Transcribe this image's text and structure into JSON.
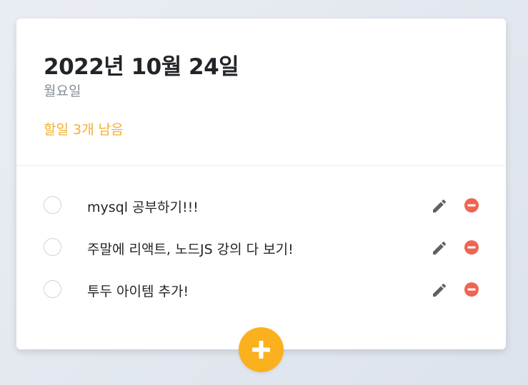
{
  "header": {
    "date": "2022년 10월 24일",
    "weekday": "월요일",
    "tasks_left": "할일 3개 남음"
  },
  "todos": [
    {
      "text": "mysql 공부하기!!!",
      "done": false
    },
    {
      "text": "주말에 리액트, 노드JS 강의 다 보기!",
      "done": false
    },
    {
      "text": "투두 아이템 추가!",
      "done": false
    }
  ],
  "icons": {
    "edit": "pencil-icon",
    "remove": "minus-circle-icon",
    "add": "plus-icon"
  },
  "colors": {
    "accent": "#f5ae2b",
    "remove": "#ef6452",
    "add_button": "#fbb11e"
  }
}
